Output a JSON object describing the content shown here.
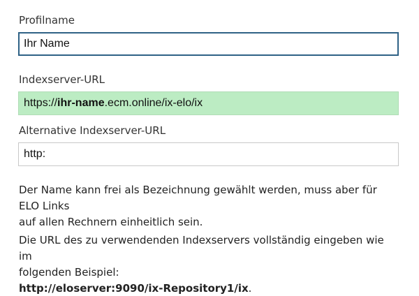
{
  "form": {
    "profile_name": {
      "label": "Profilname",
      "value": "Ihr Name"
    },
    "index_server_url": {
      "label": "Indexserver-URL",
      "value_prefix": "https://",
      "value_bold": "ihr-name",
      "value_suffix": ".ecm.online/ix-elo/ix",
      "highlight_color": "#bcecc3"
    },
    "alt_index_server_url": {
      "label": "Alternative Indexserver-URL",
      "value": "http:"
    }
  },
  "help": {
    "name_hint_line1": "Der Name kann frei als Bezeichnung gewählt werden, muss aber für ELO Links",
    "name_hint_line2": "auf allen Rechnern einheitlich sein.",
    "url_hint_line1": "Die URL des zu verwendenden Indexservers vollständig eingeben wie im",
    "url_hint_line2": "folgenden Beispiel:",
    "url_example": "http://eloserver:9090/ix-Repository1/ix",
    "url_example_end": "."
  },
  "colors": {
    "focus_border": "#2f6286",
    "input_border": "#c8c8c8"
  }
}
